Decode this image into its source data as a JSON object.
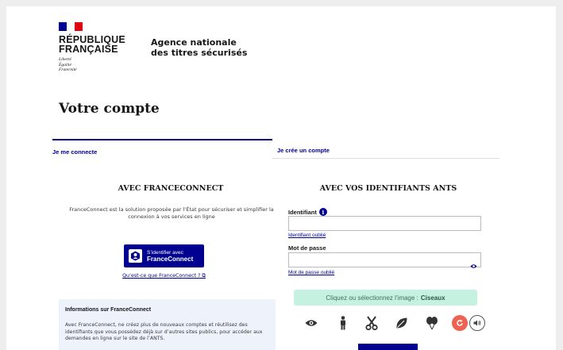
{
  "header": {
    "republique": "RÉPUBLIQUE",
    "francaise": "FRANÇAISE",
    "motto": [
      "Liberté",
      "Égalité",
      "Fraternité"
    ],
    "agency_line1": "Agence nationale",
    "agency_line2": "des titres sécurisés"
  },
  "page_title": "Votre compte",
  "tabs": [
    {
      "label": "Je me connecte"
    },
    {
      "label": "Je crée un compte"
    }
  ],
  "franceconnect": {
    "heading": "AVEC FRANCECONNECT",
    "description": "FranceConnect est la solution proposée par l’État pour sécuriser et simplifier la connexion à vos services en ligne",
    "button_line1": "S’identifier avec",
    "button_line2": "FranceConnect",
    "what_link": "Qu’est-ce que FranceConnect ? ⧉",
    "info_title": "Informations sur FranceConnect",
    "info_text": "Avec FranceConnect, ne créez plus de nouveaux comptes et réutilisez des identifiants que vous possédez déjà sur d’autres sites publics, pour accéder aux demandes en ligne sur le site de l’ANTS."
  },
  "ants": {
    "heading": "AVEC VOS IDENTIFIANTS ANTS",
    "identifier_label": "Identifiant",
    "identifier_value": "",
    "identifier_forgot": "Identifiant oublié",
    "password_label": "Mot de passe",
    "password_value": "",
    "password_forgot": "Mot de passe oublié",
    "captcha_prompt": "Cliquez ou sélectionnez l’image :",
    "captcha_target": "Ciseaux",
    "captcha_icons": [
      "eye-icon",
      "person-icon",
      "scissors-icon",
      "leaf-icon",
      "balloons-icon"
    ]
  },
  "colors": {
    "primary": "#000091",
    "captcha_bg": "#c5f2e0",
    "refresh": "#ef6150"
  }
}
